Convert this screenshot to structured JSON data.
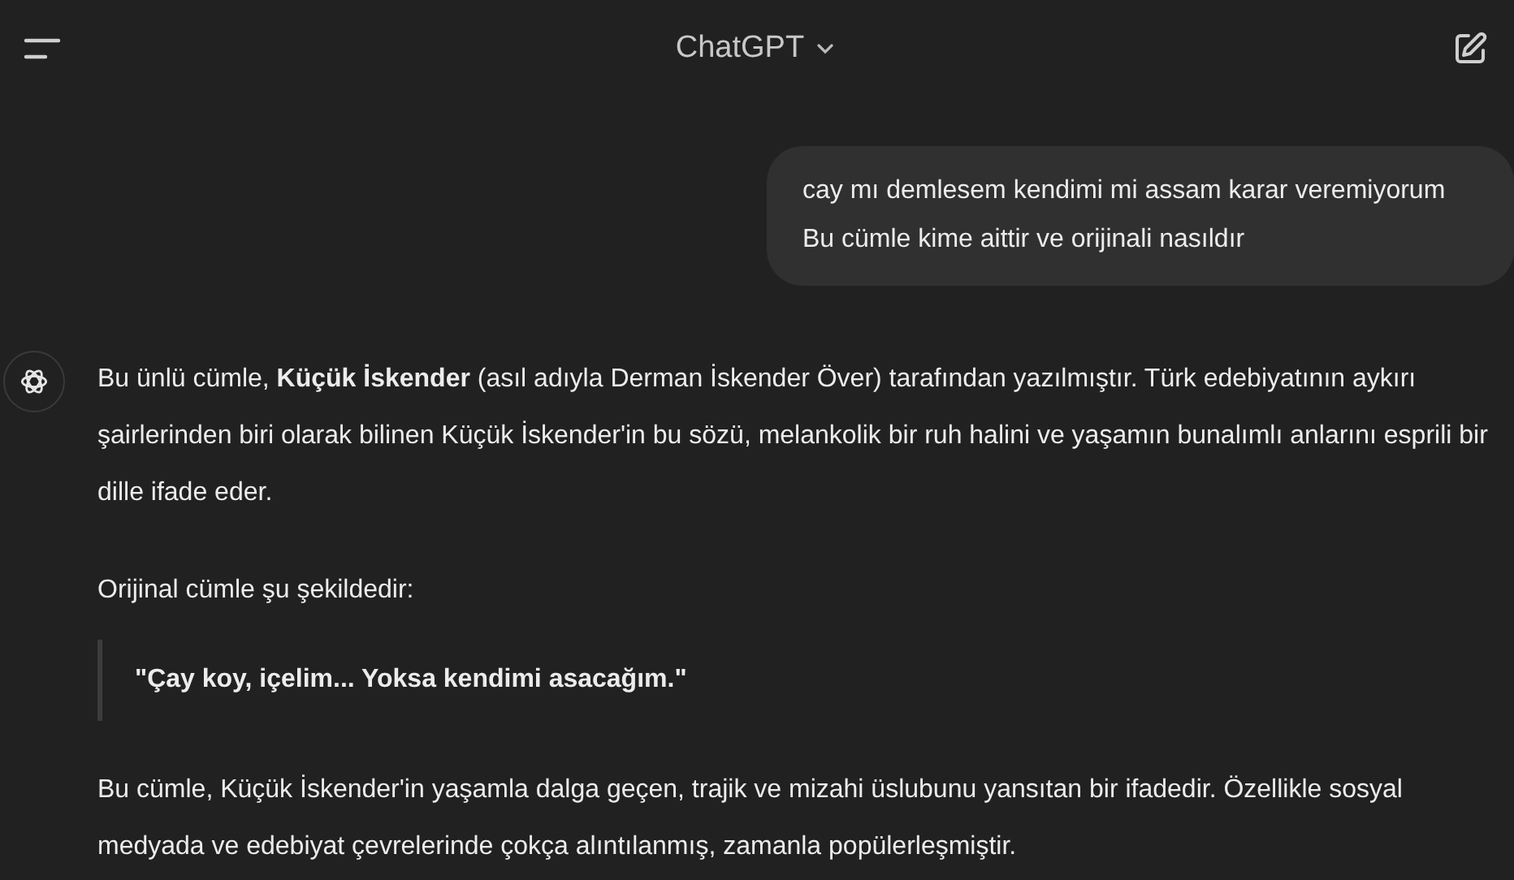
{
  "header": {
    "title": "ChatGPT"
  },
  "messages": [
    {
      "kind": "user",
      "text": "cay mı demlesem kendimi mi assam karar veremiyorum Bu cümle kime aittir ve orijinali nasıldır"
    },
    {
      "kind": "assistant",
      "blocks": [
        {
          "kind": "paragraph",
          "text": "Bu ünlü cümle, **Küçük İskender** (asıl adıyla Derman İskender Över) tarafından yazılmıştır. Türk edebiyatının aykırı şairlerinden biri olarak bilinen Küçük İskender'in bu sözü, melankolik bir ruh halini ve yaşamın bunalımlı anlarını esprili bir dille ifade eder."
        },
        {
          "kind": "paragraph",
          "text": "Orijinal cümle şu şekildedir:"
        },
        {
          "kind": "quote",
          "text": "\"Çay koy, içelim... Yoksa kendimi asacağım.\""
        },
        {
          "kind": "paragraph",
          "text": "Bu cümle, Küçük İskender'in yaşamla dalga geçen, trajik ve mizahi üslubunu yansıtan bir ifadedir. Özellikle sosyal medyada ve edebiyat çevrelerinde çokça alıntılanmış, zamanla popülerleşmiştir."
        }
      ]
    }
  ]
}
